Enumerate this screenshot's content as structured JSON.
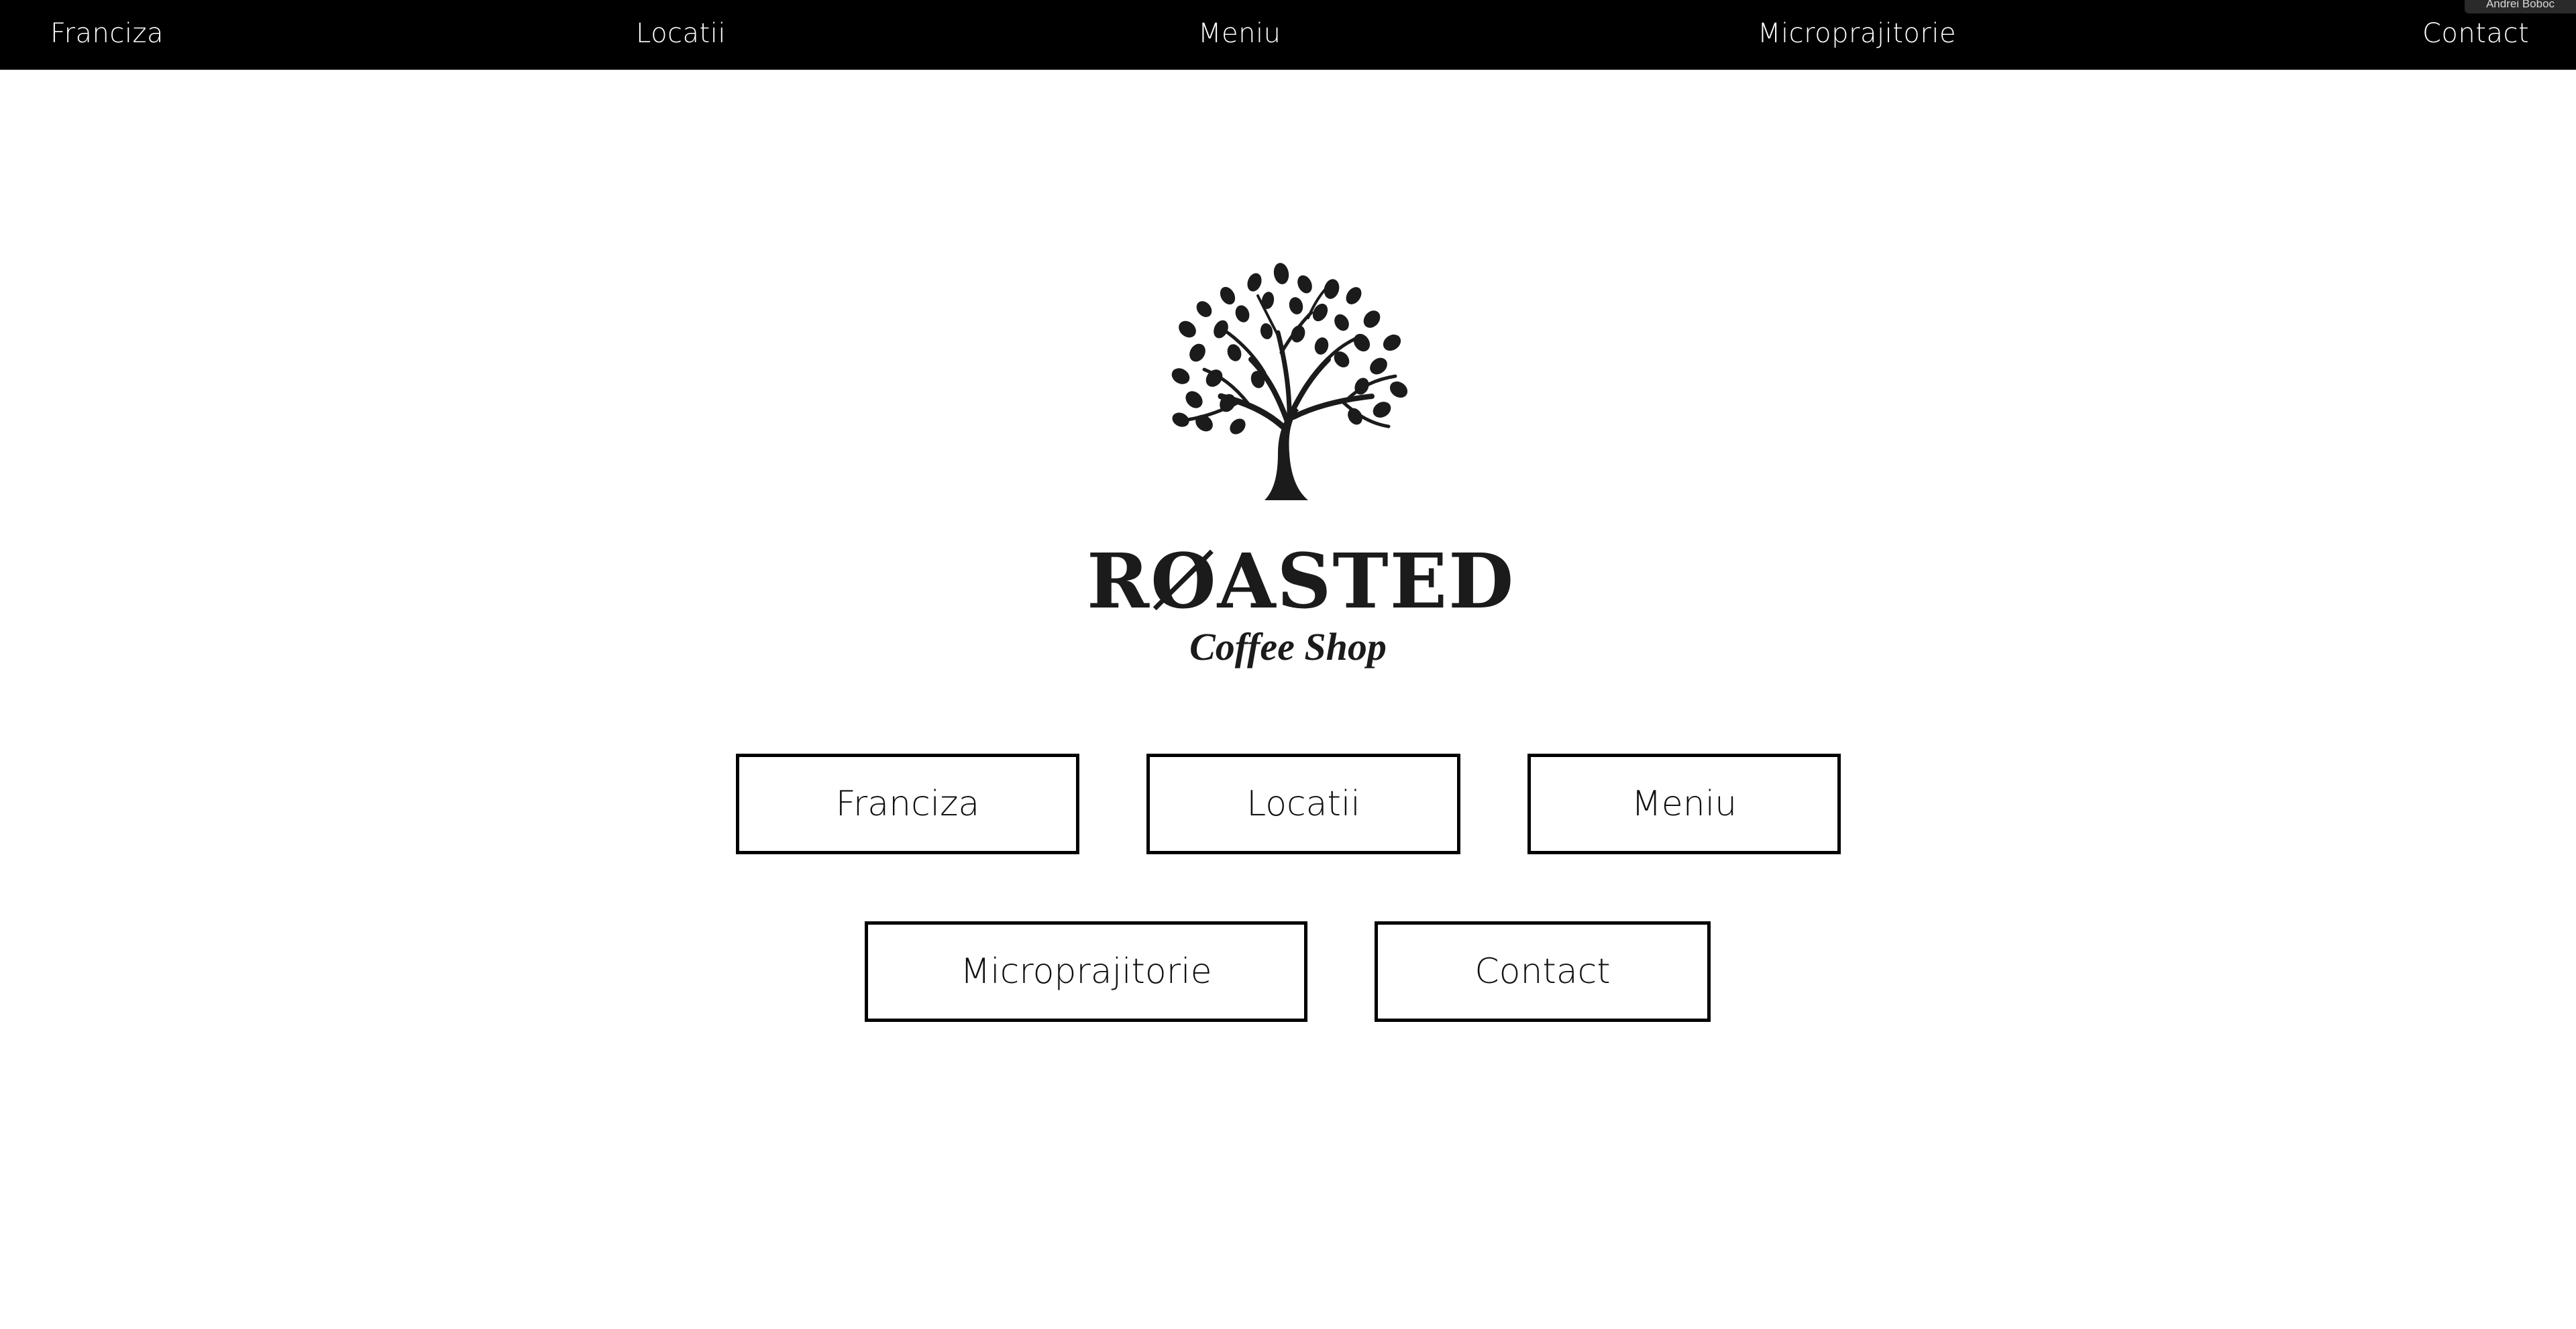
{
  "nav": {
    "items": [
      {
        "label": "Franciza"
      },
      {
        "label": "Locatii"
      },
      {
        "label": "Meniu"
      },
      {
        "label": "Microprajitorie"
      },
      {
        "label": "Contact"
      }
    ]
  },
  "user_badge": "Andrei Boboc",
  "brand": {
    "title": "RØASTED",
    "subtitle": "Coffee Shop",
    "logo_icon": "coffee-tree-icon"
  },
  "buttons": [
    {
      "label": "Franciza"
    },
    {
      "label": "Locatii"
    },
    {
      "label": "Meniu"
    },
    {
      "label": "Microprajitorie"
    },
    {
      "label": "Contact"
    }
  ],
  "colors": {
    "nav_background": "#000000",
    "nav_text": "#ffffff",
    "page_background": "#ffffff",
    "button_border": "#000000"
  }
}
